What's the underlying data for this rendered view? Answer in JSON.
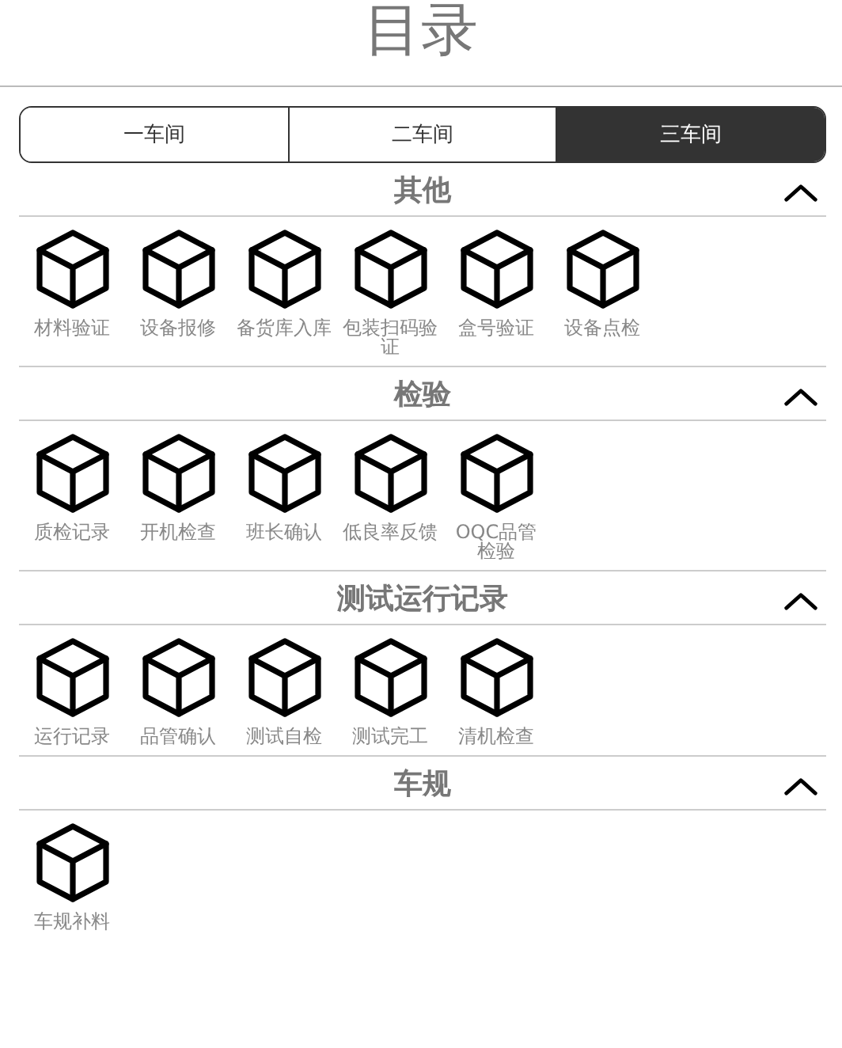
{
  "title": "目录",
  "tabs": [
    {
      "label": "一车间",
      "selected": false
    },
    {
      "label": "二车间",
      "selected": false
    },
    {
      "label": "三车间",
      "selected": true
    }
  ],
  "sections": [
    {
      "title": "其他",
      "expanded": true,
      "items": [
        "材料验证",
        "设备报修",
        "备货库入库",
        "包装扫码验证",
        "盒号验证",
        "设备点检"
      ]
    },
    {
      "title": "检验",
      "expanded": true,
      "items": [
        "质检记录",
        "开机检查",
        "班长确认",
        "低良率反馈",
        "OQC品管检验"
      ]
    },
    {
      "title": "测试运行记录",
      "expanded": true,
      "items": [
        "运行记录",
        "品管确认",
        "测试自检",
        "测试完工",
        "清机检查"
      ]
    },
    {
      "title": "车规",
      "expanded": true,
      "items": [
        "车规补料"
      ]
    }
  ]
}
